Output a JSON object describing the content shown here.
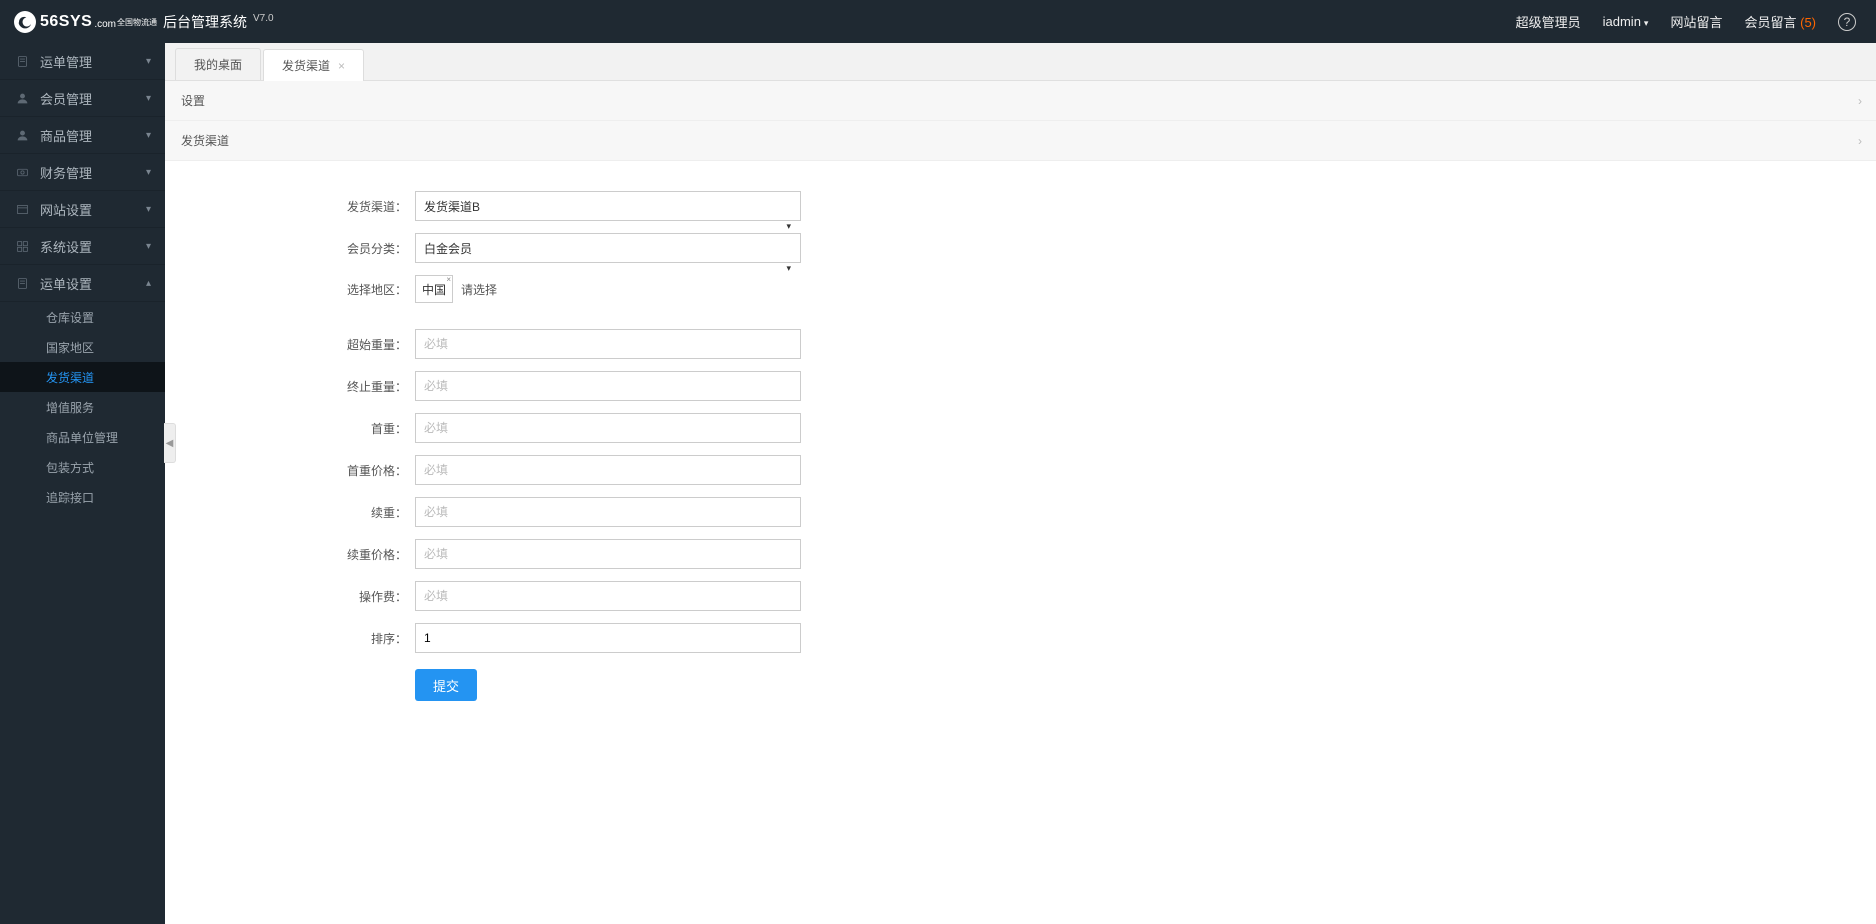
{
  "header": {
    "logo_main": "56SYS",
    "logo_dom": ".com",
    "logo_sub": "全国物流通",
    "title": "后台管理系统",
    "version": "V7.0",
    "role": "超级管理员",
    "user": "iadmin",
    "site_msg": "网站留言",
    "member_msg": "会员留言",
    "member_msg_count": "(5)"
  },
  "sidebar": {
    "items": [
      {
        "label": "运单管理",
        "icon": "doc"
      },
      {
        "label": "会员管理",
        "icon": "user"
      },
      {
        "label": "商品管理",
        "icon": "user"
      },
      {
        "label": "财务管理",
        "icon": "money"
      },
      {
        "label": "网站设置",
        "icon": "window"
      },
      {
        "label": "系统设置",
        "icon": "grid"
      },
      {
        "label": "运单设置",
        "icon": "doc",
        "open": true
      }
    ],
    "subitems": [
      {
        "label": "仓库设置"
      },
      {
        "label": "国家地区"
      },
      {
        "label": "发货渠道",
        "active": true
      },
      {
        "label": "增值服务"
      },
      {
        "label": "商品单位管理"
      },
      {
        "label": "包装方式"
      },
      {
        "label": "追踪接口"
      }
    ]
  },
  "tabs": [
    {
      "label": "我的桌面",
      "closable": false,
      "active": false
    },
    {
      "label": "发货渠道",
      "closable": true,
      "active": true
    }
  ],
  "sections": {
    "s1": "设置",
    "s2": "发货渠道"
  },
  "form": {
    "channel_label": "发货渠道：",
    "channel_value": "发货渠道B",
    "member_label": "会员分类：",
    "member_value": "白金会员",
    "region_label": "选择地区：",
    "region_tag": "中国",
    "region_hint": "请选择",
    "start_weight_label": "超始重量：",
    "end_weight_label": "终止重量：",
    "first_weight_label": "首重：",
    "first_price_label": "首重价格：",
    "cont_weight_label": "续重：",
    "cont_price_label": "续重价格：",
    "op_fee_label": "操作费：",
    "sort_label": "排序：",
    "sort_value": "1",
    "placeholder": "必填",
    "submit": "提交"
  }
}
